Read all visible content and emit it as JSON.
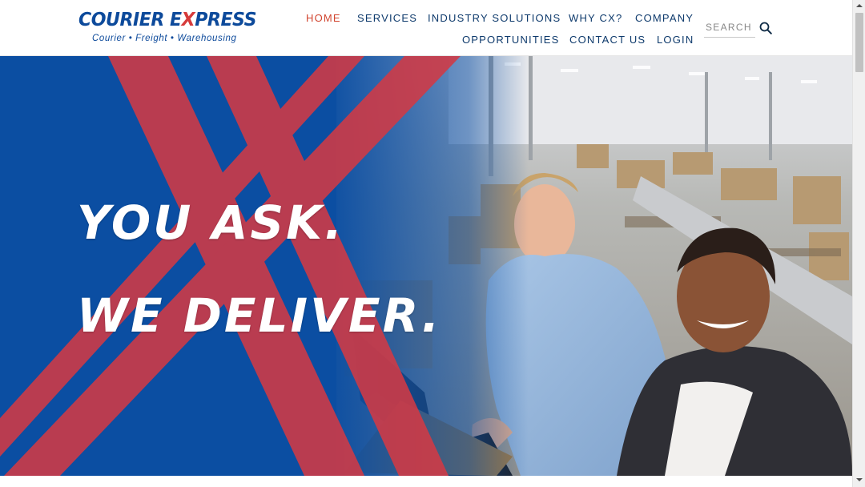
{
  "brand": {
    "name_before_x": "COURIER E",
    "name_x": "X",
    "name_after_x": "PRESS",
    "tagline": "Courier • Freight • Warehousing"
  },
  "nav": {
    "row1": [
      {
        "label": "HOME",
        "active": true
      },
      {
        "label": "SERVICES",
        "active": false
      },
      {
        "label": "INDUSTRY SOLUTIONS",
        "active": false
      },
      {
        "label": "WHY CX?",
        "active": false
      },
      {
        "label": "COMPANY",
        "active": false
      }
    ],
    "row2": [
      {
        "label": "OPPORTUNITIES",
        "active": false
      },
      {
        "label": "CONTACT US",
        "active": false
      },
      {
        "label": "LOGIN",
        "active": false
      }
    ]
  },
  "search": {
    "placeholder": "SEARCH",
    "icon": "magnifier-icon"
  },
  "hero": {
    "line1": "YOU ASK.",
    "line2": "WE DELIVER."
  },
  "colors": {
    "brand_blue": "#0d4a9b",
    "brand_red": "#d63b3b",
    "nav_text": "#0e3a6c",
    "nav_active": "#d1452f",
    "hero_blue": "#0b4ea2"
  }
}
